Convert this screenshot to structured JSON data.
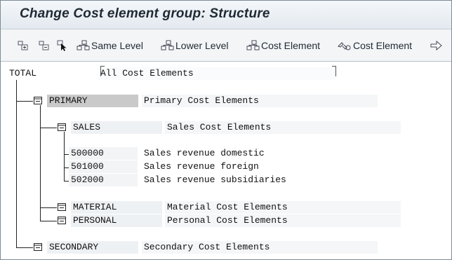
{
  "window": {
    "title": "Change Cost element group: Structure"
  },
  "toolbar": {
    "expand_icon": "expand-subtree-icon",
    "collapse_icon": "collapse-subtree-icon",
    "select_icon": "select-pointer-icon",
    "same_level": "Same Level",
    "lower_level": "Lower Level",
    "cost_element": "Cost Element",
    "cost_element_2": "Cost Element",
    "transfer_icon": "transfer-arrow-icon"
  },
  "tree": {
    "root": {
      "key": "TOTAL",
      "text": "All Cost Elements"
    },
    "primary": {
      "key": "PRIMARY",
      "text": "Primary Cost Elements",
      "sales": {
        "key": "SALES",
        "text": "Sales Cost Elements",
        "elements": [
          {
            "key": "500000",
            "text": "Sales revenue domestic"
          },
          {
            "key": "501000",
            "text": "Sales revenue foreign"
          },
          {
            "key": "502000",
            "text": "Sales revenue subsidiaries"
          }
        ]
      },
      "material": {
        "key": "MATERIAL",
        "text": "Material Cost Elements"
      },
      "personal": {
        "key": "PERSONAL",
        "text": "Personal Cost Elements"
      }
    },
    "secondary": {
      "key": "SECONDARY",
      "text": "Secondary Cost Elements"
    }
  }
}
